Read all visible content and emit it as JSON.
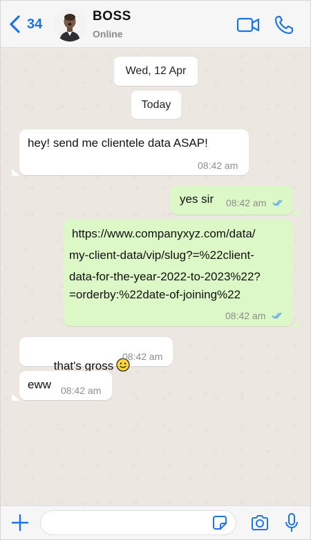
{
  "header": {
    "back_count": "34",
    "contact_name": "BOSS",
    "status": "Online"
  },
  "colors": {
    "accent": "#1b73e8",
    "outgoing_bubble": "#dcf8c6",
    "incoming_bubble": "#ffffff",
    "read_ticks": "#5aa6ea"
  },
  "chat": {
    "date_label": "Wed, 12 Apr",
    "day_label": "Today",
    "messages": [
      {
        "direction": "incoming",
        "text": "hey! send me clientele data ASAP!",
        "time": "08:42 am"
      },
      {
        "direction": "outgoing",
        "text": "yes sir",
        "time": "08:42 am",
        "status": "read"
      },
      {
        "direction": "outgoing",
        "lines": [
          "https://www.companyxyz.com/data/",
          "my-client-data/vip/slug?=%22client-",
          "data-for-the-year-2022-to-2023%22?",
          "=orderby:%22date-of-joining%22"
        ],
        "time": "08:42 am",
        "status": "read"
      },
      {
        "direction": "incoming",
        "text": "that's gross",
        "emoji": "slightly-smiling-face",
        "time": "08:42 am"
      },
      {
        "direction": "incoming",
        "text": "eww",
        "time": "08:42 am"
      }
    ]
  },
  "footer": {
    "input_placeholder": "",
    "icons": [
      "plus-icon",
      "sticker-icon",
      "camera-icon",
      "mic-icon"
    ]
  }
}
